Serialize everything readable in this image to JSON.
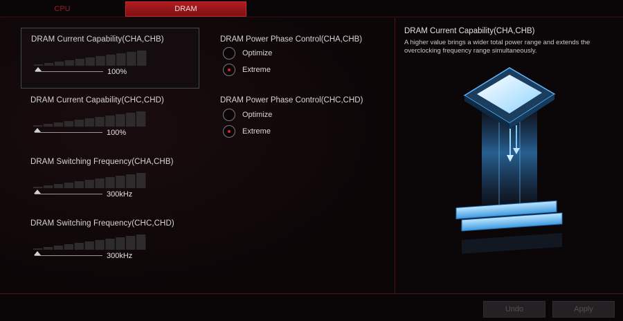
{
  "tabs": [
    {
      "label": "CPU",
      "active": false
    },
    {
      "label": "DRAM",
      "active": true
    }
  ],
  "settings": [
    {
      "title": "DRAM Current Capability(CHA,CHB)",
      "value": "100%",
      "level": 0,
      "selected": true
    },
    {
      "title": "DRAM Current Capability(CHC,CHD)",
      "value": "100%",
      "level": 0,
      "selected": false
    },
    {
      "title": "DRAM Switching Frequency(CHA,CHB)",
      "value": "300kHz",
      "level": 0,
      "selected": false
    },
    {
      "title": "DRAM Switching Frequency(CHC,CHD)",
      "value": "300kHz",
      "level": 0,
      "selected": false
    }
  ],
  "phase_groups": [
    {
      "title": "DRAM Power Phase Control(CHA,CHB)",
      "options": [
        {
          "label": "Optimize",
          "checked": false
        },
        {
          "label": "Extreme",
          "checked": true
        }
      ]
    },
    {
      "title": "DRAM Power Phase Control(CHC,CHD)",
      "options": [
        {
          "label": "Optimize",
          "checked": false
        },
        {
          "label": "Extreme",
          "checked": true
        }
      ]
    }
  ],
  "help": {
    "title": "DRAM Current Capability(CHA,CHB)",
    "description": "A higher value brings a wider total power range and extends the overclocking frequency range simultaneously.",
    "illustration": "chip-and-ram-modules-illustration"
  },
  "buttons": {
    "undo": "Undo",
    "apply": "Apply",
    "enabled": false
  },
  "colors": {
    "accent": "#c8282d",
    "background": "#0c0607",
    "radio_dot": "#e0202a",
    "illustration_glow": "#3fa9ff"
  },
  "icons": {
    "thumb": "triangle-up-icon",
    "radio": "radio-button-icon"
  }
}
